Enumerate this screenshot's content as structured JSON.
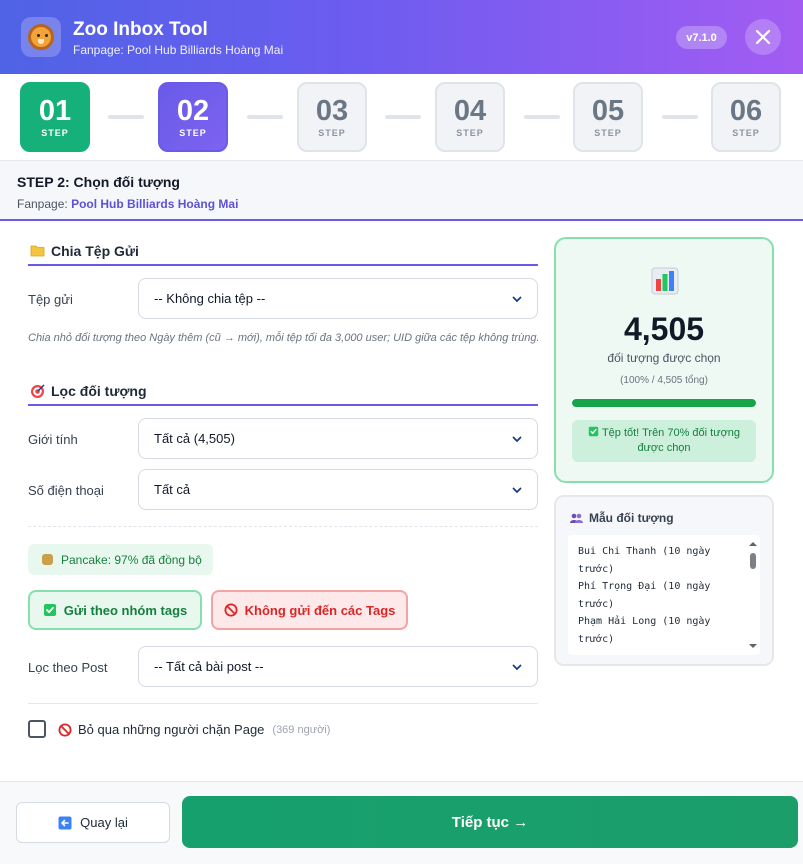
{
  "header": {
    "title": "Zoo Inbox Tool",
    "subtitle": "Fanpage: Pool Hub Billiards Hoàng Mai",
    "version": "v7.1.0",
    "logo_icon": "lion-logo-icon",
    "colors": {
      "gradient_start": "#4f63e6",
      "gradient_end": "#a35cf2"
    }
  },
  "steps": [
    {
      "number": "01",
      "label": "STEP",
      "state": "done"
    },
    {
      "number": "02",
      "label": "STEP",
      "state": "active"
    },
    {
      "number": "03",
      "label": "STEP",
      "state": "pending"
    },
    {
      "number": "04",
      "label": "STEP",
      "state": "pending"
    },
    {
      "number": "05",
      "label": "STEP",
      "state": "pending"
    },
    {
      "number": "06",
      "label": "STEP",
      "state": "pending"
    }
  ],
  "step_header": {
    "title": "STEP 2: Chọn đối tượng",
    "fanpage_prefix": "Fanpage:",
    "fanpage_name": "Pool Hub Billiards Hoàng Mai"
  },
  "split_section": {
    "title": "Chia Tệp Gửi",
    "icon": "folder-icon",
    "file_label": "Tệp gửi",
    "file_value": "-- Không chia tệp --",
    "hint": "Chia nhỏ đối tượng theo Ngày thêm (cũ → mới), mỗi tệp tối đa 3,000 user; UID giữa các tệp không trùng."
  },
  "filter_section": {
    "title": "Lọc đối tượng",
    "icon": "target-icon",
    "gender_label": "Giới tính",
    "gender_value": "Tất cả (4,505)",
    "phone_label": "Số điện thoại",
    "phone_value": "Tất cả",
    "sync_badge": "Pancake: 97% đã đồng bộ",
    "send_by_tags": "Gửi theo nhóm tags",
    "exclude_tags": "Không gửi đến các Tags",
    "post_label": "Lọc theo Post",
    "post_value": "-- Tất cả bài post --",
    "skip_blocked_label": "Bỏ qua những người chặn Page",
    "skip_blocked_count": "(369 người)",
    "skip_blocked_checked": false
  },
  "stats": {
    "icon": "bar-chart-icon",
    "count": "4,505",
    "caption": "đối tượng được chọn",
    "percent_text": "(100% / 4,505 tổng)",
    "progress": 1.0,
    "note": "Tệp tốt! Trên 70% đối tượng được chọn"
  },
  "sample": {
    "title": "Mẫu đối tượng",
    "icon": "users-icon",
    "lines": [
      "Bui Chi Thanh (10 ngày",
      "trước)",
      "Phí Trọng Đại (10 ngày",
      "trước)",
      "Phạm Hải Long (10 ngày",
      "trước)"
    ]
  },
  "footer": {
    "back_label": "Quay lại",
    "next_label": "Tiếp tục →"
  }
}
